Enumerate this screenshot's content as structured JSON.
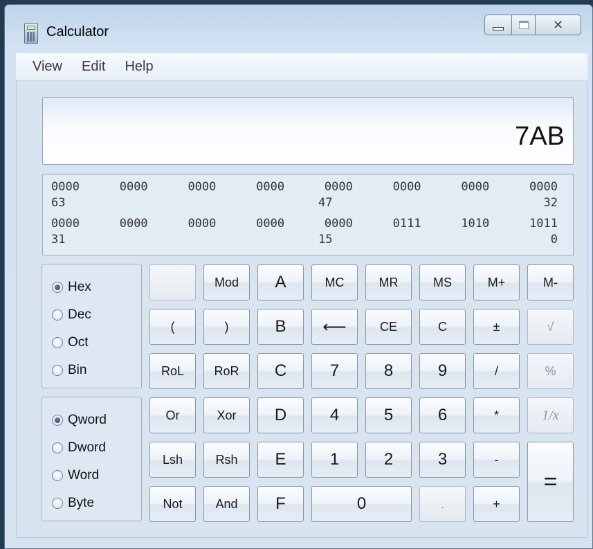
{
  "window": {
    "title": "Calculator"
  },
  "menu": [
    "View",
    "Edit",
    "Help"
  ],
  "display": {
    "value": "7AB"
  },
  "bits": {
    "row1_groups": [
      "0000",
      "0000",
      "0000",
      "0000",
      "0000",
      "0000",
      "0000",
      "0000"
    ],
    "row1_labels": [
      "63",
      "47",
      "32"
    ],
    "row2_groups": [
      "0000",
      "0000",
      "0000",
      "0000",
      "0000",
      "0111",
      "1010",
      "1011"
    ],
    "row2_labels": [
      "31",
      "15",
      "0"
    ]
  },
  "base_options": [
    {
      "label": "Hex",
      "selected": true
    },
    {
      "label": "Dec",
      "selected": false
    },
    {
      "label": "Oct",
      "selected": false
    },
    {
      "label": "Bin",
      "selected": false
    }
  ],
  "word_options": [
    {
      "label": "Qword",
      "selected": true
    },
    {
      "label": "Dword",
      "selected": false
    },
    {
      "label": "Word",
      "selected": false
    },
    {
      "label": "Byte",
      "selected": false
    }
  ],
  "keys": {
    "blank": "",
    "mod": "Mod",
    "a": "A",
    "mc": "MC",
    "mr": "MR",
    "ms": "MS",
    "mplus": "M+",
    "mminus": "M-",
    "lparen": "(",
    "rparen": ")",
    "b": "B",
    "backspace": "⟵",
    "ce": "CE",
    "c": "C",
    "plusminus": "±",
    "sqrt": "√",
    "rol": "RoL",
    "ror": "RoR",
    "cc": "C",
    "seven": "7",
    "eight": "8",
    "nine": "9",
    "divide": "/",
    "percent": "%",
    "or": "Or",
    "xor": "Xor",
    "d": "D",
    "four": "4",
    "five": "5",
    "six": "6",
    "multiply": "*",
    "reciprocal": "1/x",
    "lsh": "Lsh",
    "rsh": "Rsh",
    "e": "E",
    "one": "1",
    "two": "2",
    "three": "3",
    "minus": "-",
    "equals": "=",
    "not": "Not",
    "and": "And",
    "f": "F",
    "zero": "0",
    "dot": ".",
    "plus": "+"
  }
}
